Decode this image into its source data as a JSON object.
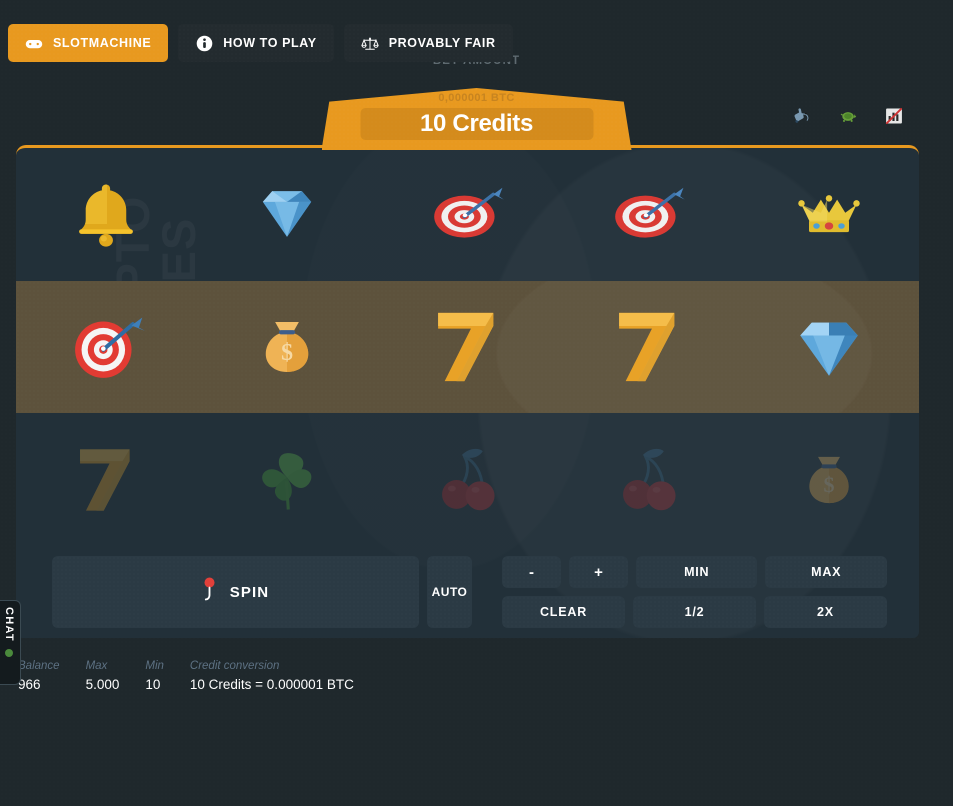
{
  "nav": {
    "items": [
      {
        "label": "SLOTMACHINE",
        "icon": "gamepad-icon",
        "active": true
      },
      {
        "label": "HOW TO PLAY",
        "icon": "info-icon",
        "active": false
      },
      {
        "label": "PROVABLY FAIR",
        "icon": "scales-icon",
        "active": false
      }
    ]
  },
  "bet": {
    "label": "BET AMOUNT",
    "btc": "0,000001 BTC",
    "value": "10 Credits"
  },
  "speed_icons": [
    {
      "name": "rabbit-fast-icon"
    },
    {
      "name": "turtle-slow-icon"
    },
    {
      "name": "chart-muted-icon"
    }
  ],
  "watermark": {
    "line1": "CRYPTO",
    "line2": "GAMES"
  },
  "reels": {
    "rows": [
      {
        "state": "normal",
        "symbols": [
          "bell",
          "diamond",
          "dartboard",
          "dartboard",
          "crown"
        ]
      },
      {
        "state": "win",
        "symbols": [
          "dartboard",
          "moneybag",
          "seven",
          "seven",
          "diamond"
        ]
      },
      {
        "state": "dim",
        "symbols": [
          "seven",
          "clover",
          "cherries",
          "cherries",
          "moneybag"
        ]
      }
    ]
  },
  "controls": {
    "spin": "SPIN",
    "spin_icon": "slot-lever-icon",
    "auto": "AUTO",
    "minus": "-",
    "plus": "+",
    "min": "MIN",
    "max": "MAX",
    "clear": "CLEAR",
    "half": "1/2",
    "double": "2X"
  },
  "status": {
    "balance_label": "Balance",
    "balance_value": "966",
    "max_label": "Max",
    "max_value": "5.000",
    "min_label": "Min",
    "min_value": "10",
    "conversion_label": "Credit conversion",
    "conversion_value": "10 Credits = 0.000001 BTC"
  },
  "chat": {
    "label": "CHAT"
  },
  "colors": {
    "accent": "#e8991f",
    "page_bg": "#1f282c",
    "panel_bg": "#223039",
    "win_row": "#5d523c",
    "button_bg": "#2b3a44",
    "status_online": "#4a8a3c"
  }
}
